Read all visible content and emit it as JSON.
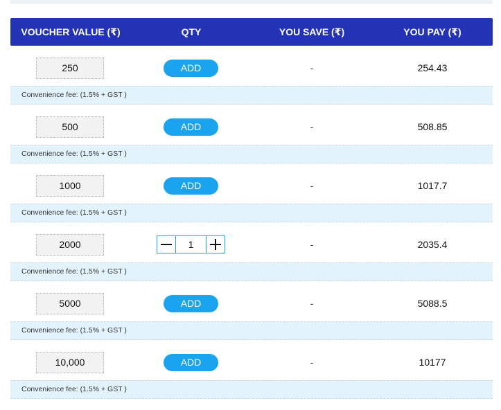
{
  "header": {
    "voucher_value": "VOUCHER VALUE (₹)",
    "qty": "QTY",
    "you_save": "YOU SAVE (₹)",
    "you_pay": "YOU PAY (₹)"
  },
  "add_label": "ADD",
  "rows": [
    {
      "value": "250",
      "save": "-",
      "pay": "254.43",
      "fee": "Convenience fee: (1.5% + GST )"
    },
    {
      "value": "500",
      "save": "-",
      "pay": "508.85",
      "fee": "Convenience fee: (1.5% + GST )"
    },
    {
      "value": "1000",
      "save": "-",
      "pay": "1017.7",
      "fee": "Convenience fee: (1.5% + GST )"
    },
    {
      "value": "2000",
      "save": "-",
      "pay": "2035.4",
      "fee": "Convenience fee: (1.5% + GST )",
      "qty": "1"
    },
    {
      "value": "5000",
      "save": "-",
      "pay": "5088.5",
      "fee": "Convenience fee: (1.5% + GST )"
    },
    {
      "value": "10,000",
      "save": "-",
      "pay": "10177",
      "fee": "Convenience fee: (1.5% + GST )"
    }
  ],
  "colors": {
    "header_bg": "#2433b5",
    "add_button": "#1aa3ef",
    "fee_bg": "#e3f3fc"
  }
}
